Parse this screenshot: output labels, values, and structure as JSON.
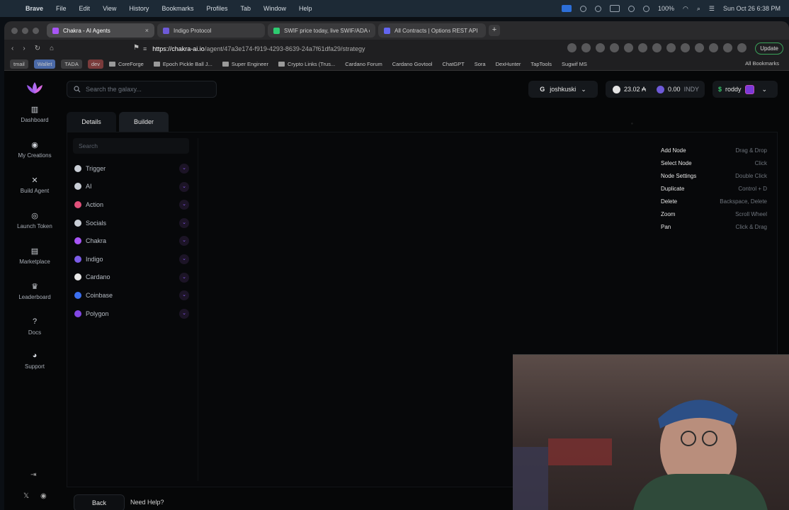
{
  "menubar": {
    "menus": [
      "Brave",
      "File",
      "Edit",
      "View",
      "History",
      "Bookmarks",
      "Profiles",
      "Tab",
      "Window",
      "Help"
    ],
    "battery": "100%",
    "datetime": "Sun Oct 26  6:38 PM"
  },
  "browser": {
    "tabs": [
      {
        "title": "Chakra - AI Agents",
        "active": true,
        "favicon_color": "#a855f7"
      },
      {
        "title": "Indigo Protocol",
        "active": false,
        "favicon_color": "#6e5ad8"
      },
      {
        "title": "SWIF price today, live SWIF/ADA c",
        "active": false,
        "favicon_color": "#2ecc71"
      },
      {
        "title": "All Contracts | Options REST API",
        "active": false,
        "favicon_color": "#6366f1"
      }
    ],
    "url_host": "https://chakra-ai.io",
    "url_path": "/agent/47a3e174-f919-4293-8639-24a7f61dfa29/strategy",
    "update_label": "Update",
    "bookmarks": [
      {
        "label": "tmail",
        "style": "pill"
      },
      {
        "label": "Wallet",
        "style": "pill-blue"
      },
      {
        "label": "TADA",
        "style": "pill"
      },
      {
        "label": "dev",
        "style": "pill-red"
      },
      {
        "label": "CoreForge",
        "style": "folder"
      },
      {
        "label": "Epoch Pickle Ball J...",
        "style": "folder"
      },
      {
        "label": "Super Engineer",
        "style": "folder"
      },
      {
        "label": "Crypto Links (Trus...",
        "style": "folder"
      },
      {
        "label": "Cardano Forum",
        "style": "link"
      },
      {
        "label": "Cardano Govtool",
        "style": "link"
      },
      {
        "label": "ChatGPT",
        "style": "link"
      },
      {
        "label": "Sora",
        "style": "link"
      },
      {
        "label": "DexHunter",
        "style": "link"
      },
      {
        "label": "TapTools",
        "style": "link"
      },
      {
        "label": "Sugwif MS",
        "style": "link"
      }
    ],
    "all_bookmarks": "All Bookmarks"
  },
  "app": {
    "search_placeholder": "Search the galaxy...",
    "nav": [
      {
        "label": "Dashboard",
        "icon": "bar-chart-icon"
      },
      {
        "label": "My Creations",
        "icon": "lightbulb-icon"
      },
      {
        "label": "Build Agent",
        "icon": "tools-icon"
      },
      {
        "label": "Launch Token",
        "icon": "coins-icon"
      },
      {
        "label": "Marketplace",
        "icon": "store-icon"
      },
      {
        "label": "Leaderboard",
        "icon": "crown-icon"
      },
      {
        "label": "Docs",
        "icon": "help-circle-icon"
      },
      {
        "label": "Support",
        "icon": "discord-icon"
      }
    ],
    "user": {
      "name": "joshkuski"
    },
    "balance": {
      "ada": "23.02 ₳",
      "indy": "0.00",
      "indy_unit": "INDY"
    },
    "handle": {
      "name": "roddy"
    },
    "tabs": [
      {
        "label": "Details",
        "selected": false
      },
      {
        "label": "Builder",
        "selected": true
      }
    ],
    "node_search_placeholder": "Search",
    "nodes": [
      {
        "label": "Trigger",
        "color": "#c9ced6"
      },
      {
        "label": "AI",
        "color": "#c9ced6"
      },
      {
        "label": "Action",
        "color": "#e0507a"
      },
      {
        "label": "Socials",
        "color": "#c9ced6"
      },
      {
        "label": "Chakra",
        "color": "#a855f7"
      },
      {
        "label": "Indigo",
        "color": "#7c5ce8"
      },
      {
        "label": "Cardano",
        "color": "#e8e8e8"
      },
      {
        "label": "Coinbase",
        "color": "#3b6ff0"
      },
      {
        "label": "Polygon",
        "color": "#8247e5"
      }
    ],
    "shortcuts": [
      {
        "action": "Add Node",
        "keys": "Drag & Drop"
      },
      {
        "action": "Select Node",
        "keys": "Click"
      },
      {
        "action": "Node Settings",
        "keys": "Double Click"
      },
      {
        "action": "Duplicate",
        "keys": "Control + D"
      },
      {
        "action": "Delete",
        "keys": "Backspace, Delete"
      },
      {
        "action": "Zoom",
        "keys": "Scroll Wheel"
      },
      {
        "action": "Pan",
        "keys": "Click & Drag"
      }
    ],
    "back_label": "Back",
    "help_label": "Need Help?"
  }
}
